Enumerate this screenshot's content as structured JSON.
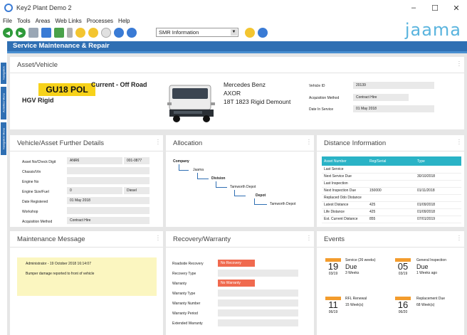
{
  "window": {
    "title": "Key2 Plant Demo 2",
    "minimize": "–",
    "maximize": "☐",
    "close": "✕"
  },
  "menu": [
    "File",
    "Tools",
    "Areas",
    "Web Links",
    "Processes",
    "Help"
  ],
  "toolbar": {
    "select_value": "SMR Information"
  },
  "logo": "jaama",
  "page_title": "Service Maintenance & Repair",
  "side_tabs": [
    "Navigation",
    "Activities Menu",
    "Navigation Menu"
  ],
  "asset": {
    "title": "Asset/Vehicle",
    "plate": "GU18 POL",
    "status": "Current - Off Road",
    "category": "HGV Rigid",
    "make": "Mercedes Benz",
    "model": "AXOR",
    "variant": "18T 1823 Rigid Demount",
    "fields": [
      {
        "label": "Vehicle ID",
        "value": "20139"
      },
      {
        "label": "Acquisition Method",
        "value": "Contract Hire"
      },
      {
        "label": "Date In Service",
        "value": "01 May 2018"
      }
    ]
  },
  "details": {
    "title": "Vehicle/Asset Further Details",
    "rows": [
      {
        "label": "Asset No/Check Digit",
        "value": "ANR6",
        "extra": "001-0877"
      },
      {
        "label": "Chassis/Vin",
        "value": "",
        "extra": ""
      },
      {
        "label": "Engine No",
        "value": "",
        "extra": ""
      },
      {
        "label": "Engine Size/Fuel",
        "value": "0",
        "extra": "Diesel"
      },
      {
        "label": "Date Registered",
        "value": "01 May 2018",
        "extra": ""
      },
      {
        "label": "Workshop",
        "value": "",
        "extra": ""
      },
      {
        "label": "Acquisition Method",
        "value": "Contract Hire",
        "extra": ""
      }
    ]
  },
  "allocation": {
    "title": "Allocation",
    "nodes": [
      "Company",
      "Jaama",
      "Division",
      "Tamworth Depot",
      "Depot",
      "Tamworth Depot"
    ]
  },
  "distance": {
    "title": "Distance Information",
    "headers": [
      "Asset Number",
      "Reg/Serial",
      "Type"
    ],
    "rows": [
      [
        "Last Service",
        "",
        ""
      ],
      [
        "Next Service Due",
        "",
        "30/10/2018"
      ],
      [
        "Last Inspection",
        "",
        ""
      ],
      [
        "Next Inspection Due",
        "150000",
        "01/11/2018"
      ],
      [
        "Replaced Odo Distance",
        "",
        ""
      ],
      [
        "Latest Distance",
        "425",
        "01/09/2018"
      ],
      [
        "Life Distance",
        "425",
        "01/09/2018"
      ],
      [
        "Est. Current Distance",
        "855",
        "07/01/2019"
      ]
    ]
  },
  "maintenance": {
    "title": "Maintenance Message",
    "author": "Administrator - 19 October 2018 16:14:07",
    "message": "Bumper damage reported to front of vehicle"
  },
  "recovery": {
    "title": "Recovery/Warranty",
    "rows": [
      {
        "label": "Roadside Recovery",
        "value": "No Recovery",
        "flag": true
      },
      {
        "label": "Recovery Type",
        "value": "",
        "flag": false
      },
      {
        "label": "Warranty",
        "value": "No Warranty",
        "flag": true
      },
      {
        "label": "Warranty Type",
        "value": "",
        "flag": false
      },
      {
        "label": "Warranty Number",
        "value": "",
        "flag": false
      },
      {
        "label": "Warranty Period",
        "value": "",
        "flag": false
      },
      {
        "label": "Extended Warranty",
        "value": "",
        "flag": false
      }
    ]
  },
  "events": {
    "title": "Events",
    "items": [
      {
        "day": "19",
        "month_year": "03/19",
        "title": "Service (26 weeks)",
        "status": "Due",
        "sub": "3 Weeks"
      },
      {
        "day": "05",
        "month_year": "03/19",
        "title": "General Inspection",
        "status": "Due",
        "sub": "1 Weeks ago"
      },
      {
        "day": "11",
        "month_year": "06/19",
        "title": "RFL Renewal",
        "status": "",
        "sub": "15 Week(s)"
      },
      {
        "day": "16",
        "month_year": "06/20",
        "title": "Replacement Due",
        "status": "",
        "sub": "68 Week(s)"
      }
    ]
  },
  "colors": {
    "accent": "#2f6fb3",
    "table_header": "#2ab3c6",
    "flag": "#f06a4f",
    "plate": "#f7d21a",
    "event": "#f39c2d",
    "note": "#fbf6c0"
  }
}
